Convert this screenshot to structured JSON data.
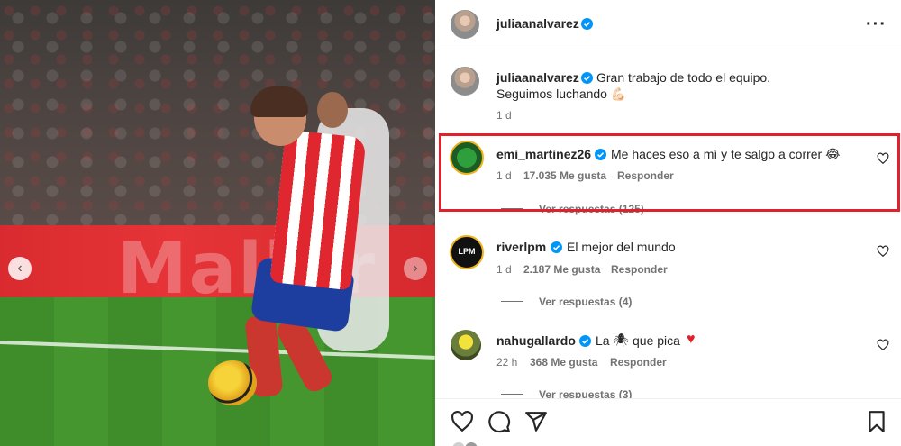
{
  "post": {
    "author": "juliaanalvarez",
    "caption_line1": "Gran trabajo de todo el equipo.",
    "caption_line2": "Seguimos luchando 💪🏻",
    "caption_time": "1 d",
    "photo_banner_text": "Mallor"
  },
  "comments": [
    {
      "username": "emi_martinez26",
      "text": "Me haces eso a mí y te salgo a correr 😂",
      "time": "1 d",
      "likes": "17.035 Me gusta",
      "reply": "Responder",
      "view_replies": "Ver respuestas (125)",
      "highlighted": true
    },
    {
      "username": "riverlpm",
      "text": "El mejor del mundo",
      "time": "1 d",
      "likes": "2.187 Me gusta",
      "reply": "Responder",
      "view_replies": "Ver respuestas (4)",
      "avatar_text": "LPM"
    },
    {
      "username": "nahugallardo",
      "text_before": "La",
      "text_emoji": "🕷",
      "text_after": "que pica",
      "text_heart": "♥",
      "time": "22 h",
      "likes": "368 Me gusta",
      "reply": "Responder",
      "view_replies": "Ver respuestas (3)"
    }
  ],
  "icons": {
    "more": "more-options-icon",
    "like": "heart-icon",
    "comment": "comment-icon",
    "share": "share-icon",
    "save": "bookmark-icon",
    "verified": "verified-badge-icon",
    "prev": "chevron-left-icon",
    "next": "chevron-right-icon"
  },
  "colors": {
    "verified": "#0095f6",
    "highlight": "#e0202a",
    "heart_red": "#e0202a"
  }
}
